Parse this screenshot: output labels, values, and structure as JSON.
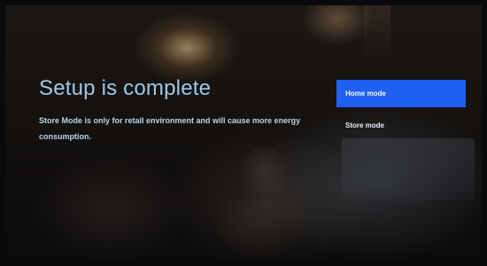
{
  "setup": {
    "title": "Setup is complete",
    "description": "Store Mode is only for retail environment and will cause more energy consumption."
  },
  "modes": {
    "selected_index": 0,
    "accent_color": "#1f5ff2",
    "items": [
      {
        "label": "Home mode"
      },
      {
        "label": "Store mode"
      }
    ]
  }
}
